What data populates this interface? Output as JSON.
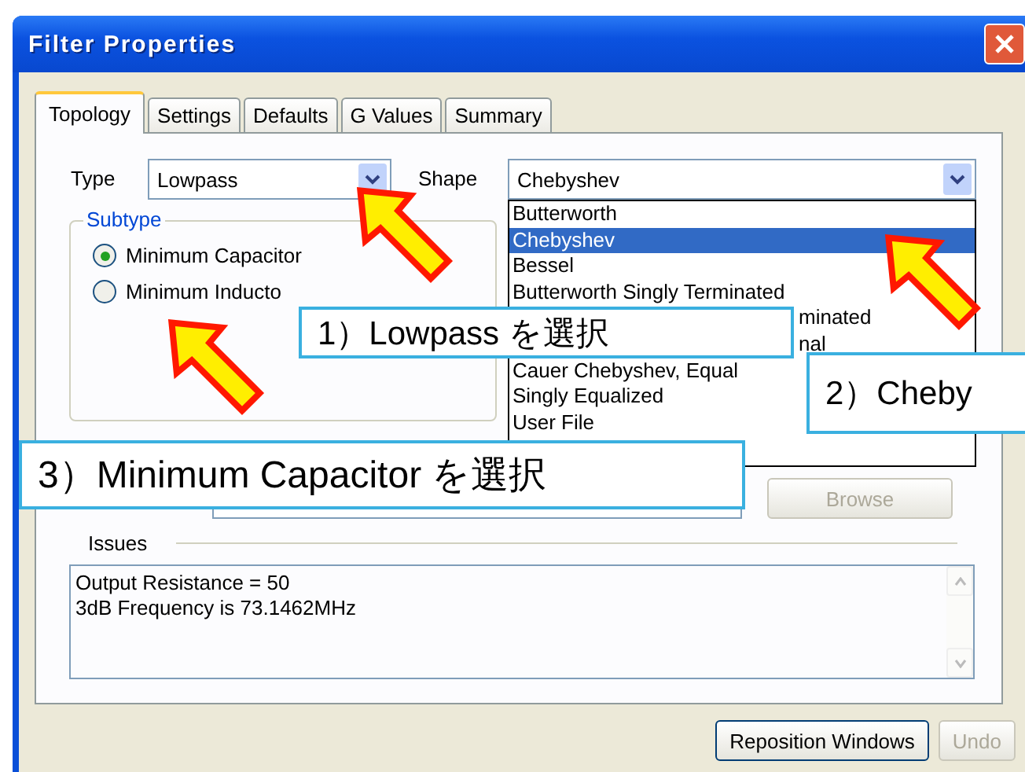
{
  "window": {
    "title": "Filter Properties"
  },
  "tabs": [
    {
      "label": "Topology",
      "selected": true
    },
    {
      "label": "Settings",
      "selected": false
    },
    {
      "label": "Defaults",
      "selected": false
    },
    {
      "label": "G Values",
      "selected": false
    },
    {
      "label": "Summary",
      "selected": false
    }
  ],
  "type": {
    "label": "Type",
    "value": "Lowpass"
  },
  "shape": {
    "label": "Shape",
    "value": "Chebyshev",
    "options": [
      {
        "text": "Butterworth",
        "selected": false,
        "covered": false
      },
      {
        "text": "Chebyshev",
        "selected": true,
        "covered": false
      },
      {
        "text": "Bessel",
        "selected": false,
        "covered": false
      },
      {
        "text": "Butterworth Singly Terminated",
        "selected": false,
        "covered": false
      },
      {
        "text": "minated",
        "selected": false,
        "covered": true
      },
      {
        "text": "nal",
        "selected": false,
        "covered": true
      },
      {
        "text": "Cauer Chebyshev, Equal",
        "selected": false,
        "covered": false
      },
      {
        "text": "Singly Equalized",
        "selected": false,
        "covered": false
      },
      {
        "text": "User File",
        "selected": false,
        "covered": false
      }
    ]
  },
  "subtype": {
    "label": "Subtype",
    "options": [
      {
        "label": "Minimum Capacitor",
        "selected": true
      },
      {
        "label": "Minimum Inducto",
        "selected": false
      }
    ]
  },
  "browse": {
    "label": "Browse",
    "disabled": true
  },
  "issues": {
    "label": "Issues",
    "lines": [
      "Output Resistance = 50",
      "3dB Frequency is 73.1462MHz"
    ]
  },
  "buttons": [
    {
      "label": "Reposition Windows",
      "disabled": false
    },
    {
      "label": "Undo",
      "disabled": true
    }
  ],
  "callouts": [
    "1）Lowpass を選択",
    "2）Cheby",
    "3）Minimum Capacitor を選択"
  ]
}
